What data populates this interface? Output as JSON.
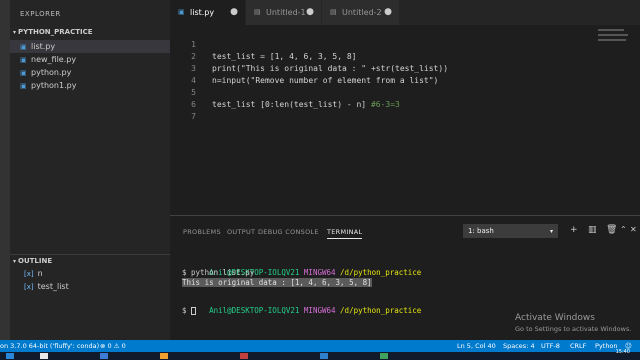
{
  "sidebar": {
    "title": "EXPLORER",
    "folder": "PYTHON_PRACTICE",
    "files": [
      "list.py",
      "new_file.py",
      "python.py",
      "python1.py"
    ],
    "outline": {
      "header": "OUTLINE",
      "items": [
        "n",
        "test_list"
      ]
    }
  },
  "tabs": [
    {
      "label": "list.py"
    },
    {
      "label": "Untitled-1"
    },
    {
      "label": "Untitled-2"
    }
  ],
  "editor": {
    "lines": [
      {
        "num": "1",
        "code": "test_list = [1, 4, 6, 3, 5, 8]"
      },
      {
        "num": "2",
        "code": "print(\"This is original data : \" +str(test_list))"
      },
      {
        "num": "3",
        "code": "n=input(\"Remove number of element from a list\")"
      },
      {
        "num": "4",
        "code": ""
      },
      {
        "num": "5",
        "code": "test_list [0:len(test_list) - n] #6-3=3"
      },
      {
        "num": "6",
        "code": ""
      },
      {
        "num": "7",
        "code": ""
      }
    ],
    "line5_code": "test_list [0:len(test_list) - n] ",
    "line5_comment": "#6-3=3"
  },
  "panel": {
    "tabs": [
      "PROBLEMS",
      "OUTPUT",
      "DEBUG CONSOLE",
      "TERMINAL"
    ],
    "terminal_select": "1: bash",
    "terminal": {
      "user": "Anil@DESKTOP-IOLQV21",
      "env": "MINGW64",
      "path": "/d/python_practice",
      "command": "$ python list.py",
      "output": "This is original data : [1, 4, 6, 3, 5, 8]",
      "prompt": "$ "
    }
  },
  "watermark": {
    "title": "Activate Windows",
    "subtitle": "Go to Settings to activate Windows."
  },
  "statusbar": {
    "interpreter": "on 3.7.0 64-bit ('fluffy': conda)",
    "errors": "0",
    "warnings": "0",
    "position": "Ln 5, Col 40",
    "spaces": "Spaces: 4",
    "encoding": "UTF-8",
    "eol": "CRLF",
    "language": "Python"
  },
  "taskbar": {
    "clock": "15:40"
  },
  "colors": {
    "statusbar": "#007acc",
    "sidebar": "#252526",
    "editor": "#1e1e1e",
    "activitybar": "#333333"
  }
}
